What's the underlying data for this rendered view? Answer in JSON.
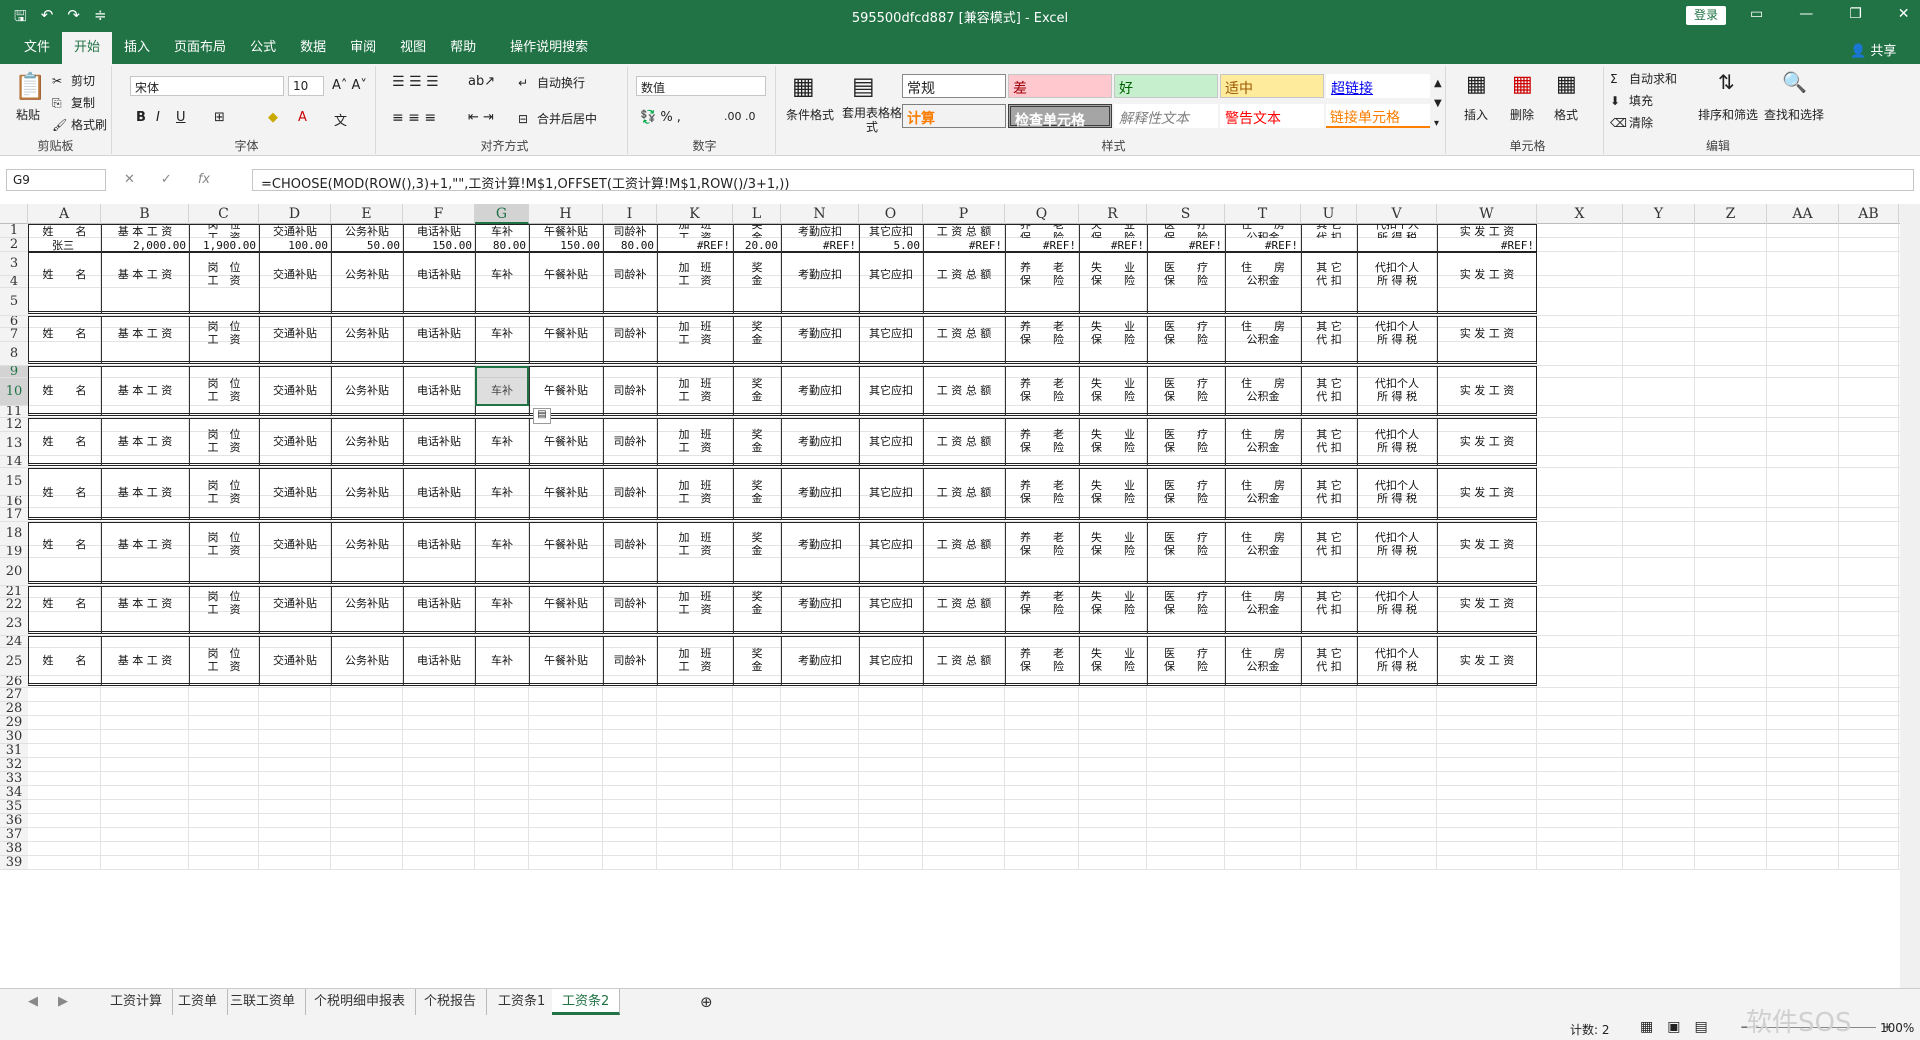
{
  "app": {
    "doc_title": "595500dfcd887  [兼容模式]  -  Excel",
    "login": "登录",
    "share": "共享"
  },
  "tabs": [
    "文件",
    "开始",
    "插入",
    "页面布局",
    "公式",
    "数据",
    "审阅",
    "视图",
    "帮助",
    "操作说明搜索"
  ],
  "ribbon": {
    "clipboard": {
      "paste": "粘贴",
      "cut": "剪切",
      "copy": "复制",
      "format_painter": "格式刷",
      "label": "剪贴板"
    },
    "font": {
      "name": "宋体",
      "size": "10",
      "label": "字体"
    },
    "align": {
      "wrap": "自动换行",
      "merge": "合并后居中",
      "label": "对齐方式"
    },
    "number": {
      "format": "数值",
      "label": "数字"
    },
    "styles": {
      "cond": "条件格式",
      "table": "套用表格格式",
      "normal": "常规",
      "bad": "差",
      "good": "好",
      "neutral": "适中",
      "hyperlink": "超链接",
      "calc": "计算",
      "check": "检查单元格",
      "explain": "解释性文本",
      "warn": "警告文本",
      "linked": "链接单元格",
      "label": "样式"
    },
    "cells": {
      "insert": "插入",
      "delete": "删除",
      "format": "格式",
      "label": "单元格"
    },
    "edit": {
      "autosum": "自动求和",
      "fill": "填充",
      "clear": "清除",
      "sort": "排序和筛选",
      "find": "查找和选择",
      "label": "编辑"
    }
  },
  "formula_bar": {
    "name_box": "G9",
    "formula": "=CHOOSE(MOD(ROW(),3)+1,\"\",工资计算!M$1,OFFSET(工资计算!M$1,ROW()/3+1,))"
  },
  "columns": [
    "A",
    "B",
    "C",
    "D",
    "E",
    "F",
    "G",
    "H",
    "I",
    "K",
    "L",
    "N",
    "O",
    "P",
    "Q",
    "R",
    "S",
    "T",
    "U",
    "V",
    "W",
    "X",
    "Y",
    "Z",
    "AA",
    "AB"
  ],
  "selected_column": "G",
  "headers": [
    "姓　　名",
    "基 本 工 资",
    "岗　位\n工　资",
    "交通补贴",
    "公务补贴",
    "电话补贴",
    "车补",
    "午餐补贴",
    "司龄补",
    "加　班\n工　资",
    "奖\n金",
    "考勤应扣",
    "其它应扣",
    "工 资 总 额",
    "养　　老\n保　　险",
    "失　　业\n保　　险",
    "医　　疗\n保　　险",
    "住　　房\n公积金",
    "其 它\n代 扣",
    "代扣个人\n所 得 税",
    "实 发 工 资"
  ],
  "row2": [
    "张三",
    "2,000.00",
    "1,900.00",
    "100.00",
    "50.00",
    "150.00",
    "80.00",
    "150.00",
    "80.00",
    "#REF!",
    "20.00",
    "#REF!",
    "5.00",
    "#REF!",
    "#REF!",
    "#REF!",
    "#REF!",
    "#REF!",
    "",
    "",
    "#REF!"
  ],
  "row_numbers": [
    "1",
    "2",
    "3",
    "4",
    "5",
    "6",
    "7",
    "8",
    "9",
    "10",
    "11",
    "12",
    "13",
    "14",
    "15",
    "16",
    "17",
    "18",
    "19",
    "20",
    "21",
    "22",
    "23",
    "24",
    "25",
    "26",
    "27",
    "28",
    "29",
    "30",
    "31",
    "32",
    "33",
    "34",
    "35",
    "36",
    "37",
    "38",
    "39"
  ],
  "sheet_tabs": [
    "工资计算",
    "工资单",
    "三联工资单",
    "个税明细申报表",
    "个税报告",
    "工资条1",
    "工资条2"
  ],
  "active_sheet": "工资条2",
  "status": {
    "count": "计数: 2",
    "zoom": "100%"
  },
  "watermark": "软件SOS"
}
